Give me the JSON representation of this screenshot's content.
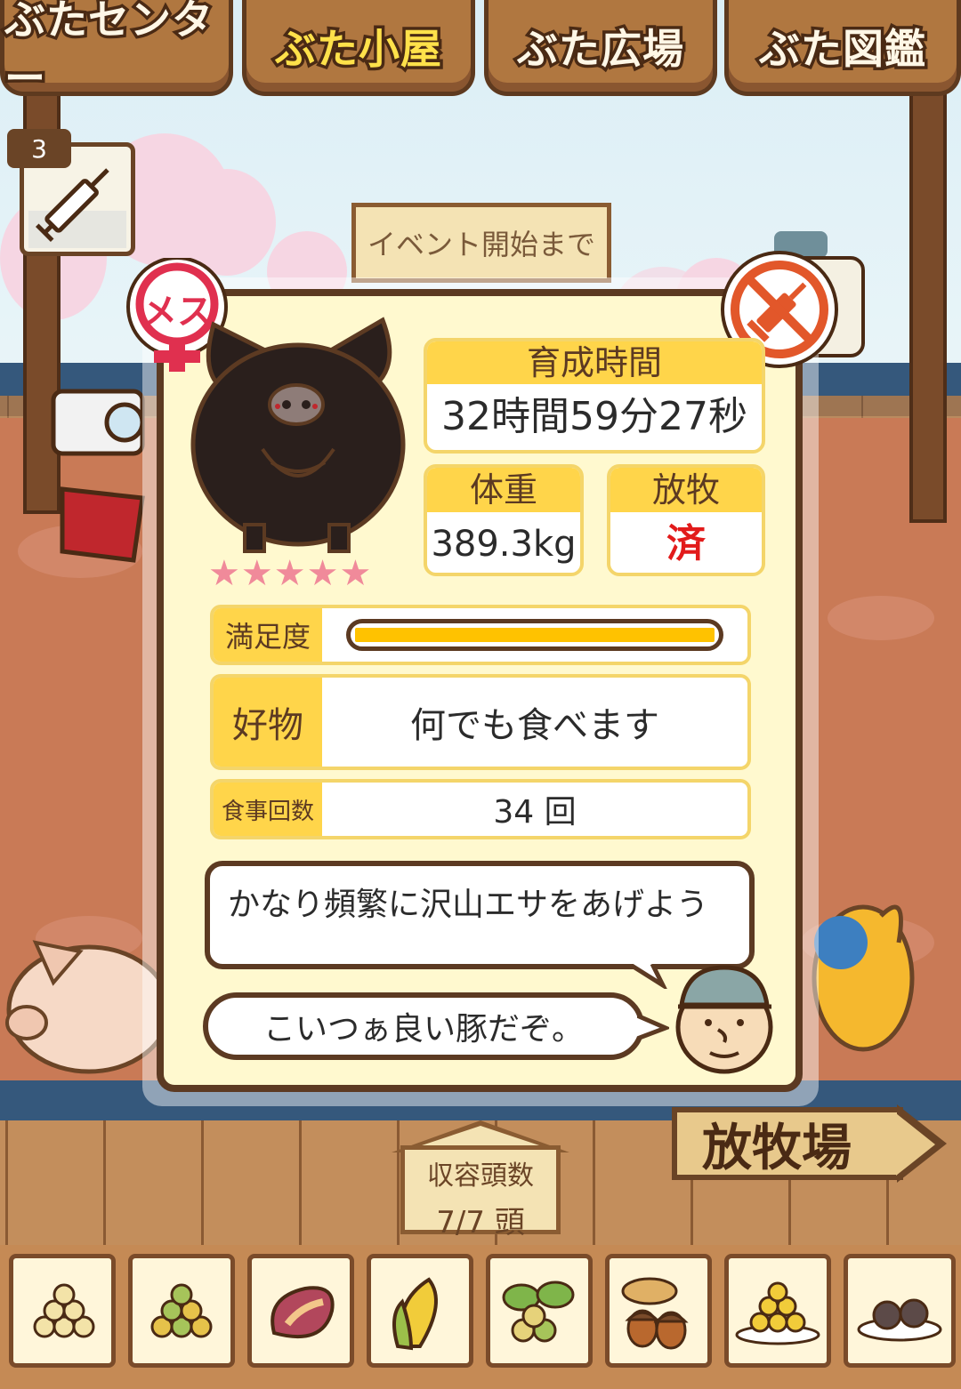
{
  "tabs": [
    {
      "label": "ぶたセンター"
    },
    {
      "label": "ぶた小屋"
    },
    {
      "label": "ぶた広場"
    },
    {
      "label": "ぶた図鑑"
    }
  ],
  "item_count": "3",
  "event_sign": "イベント開始まで",
  "pig": {
    "gender_badge": "メス",
    "stars": "★★★★★",
    "star_rating": 5
  },
  "stats": {
    "time_label": "育成時間",
    "time_value": "32時間59分27秒",
    "weight_label": "体重",
    "weight_value": "389.3kg",
    "grazing_label": "放牧",
    "grazing_value": "済",
    "satisfaction_label": "満足度",
    "satisfaction_level": 1.0,
    "favorite_label": "好物",
    "favorite_value": "何でも食べます",
    "meals_label": "食事回数",
    "meals_value": "34 回"
  },
  "advice": "かなり頻繁に沢山エサをあげよう",
  "comment": "こいつぁ良い豚だぞ。",
  "capacity": {
    "label": "収容頭数",
    "value": "7/7 頭"
  },
  "pasture_button": "放牧場",
  "foods": [
    "beans-feed",
    "mixed-feed",
    "sweet-potato",
    "corn",
    "vegetables",
    "acorns",
    "premium-feed",
    "truffles"
  ],
  "colors": {
    "accent": "#ffd54a",
    "card_bg": "#fff9cf",
    "border": "#5c3a22",
    "grazing_done": "#e21b1b",
    "star": "#f08a9a",
    "gender_female": "#e0304f"
  }
}
